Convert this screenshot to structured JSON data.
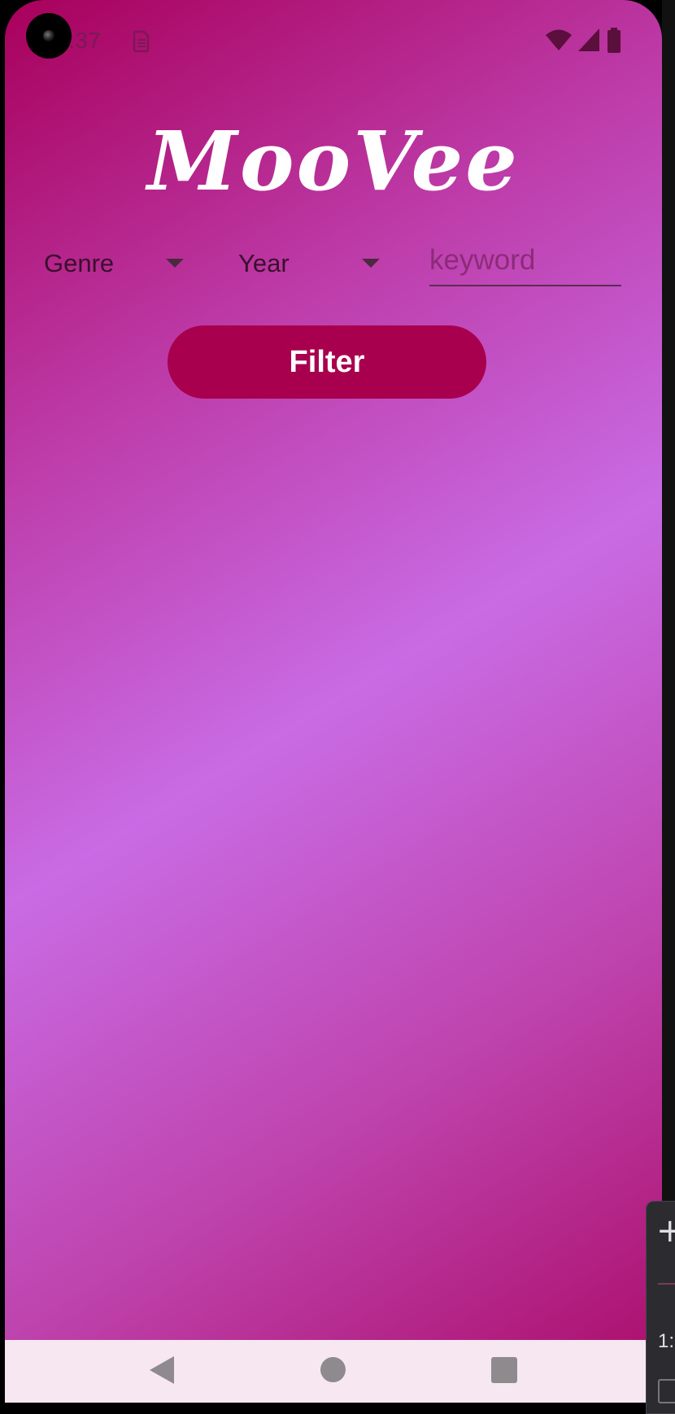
{
  "status_bar": {
    "time": "1:37",
    "notification_icon": "sim-card-icon",
    "icons": [
      "wifi-icon",
      "cell-signal-icon",
      "battery-icon"
    ],
    "icon_color": "#5a0f3d"
  },
  "app": {
    "title": "MooVee",
    "background_colors": [
      "#a8005b",
      "#c96be4",
      "#aa0a66"
    ]
  },
  "filters": {
    "genre_label": "Genre",
    "year_label": "Year",
    "keyword_placeholder": "keyword",
    "keyword_value": ""
  },
  "actions": {
    "filter_label": "Filter",
    "filter_color": "#a8004f"
  },
  "nav_bar": {
    "buttons": [
      "back-icon",
      "home-icon",
      "recents-icon"
    ]
  },
  "side_panel": {
    "text": "1:"
  }
}
